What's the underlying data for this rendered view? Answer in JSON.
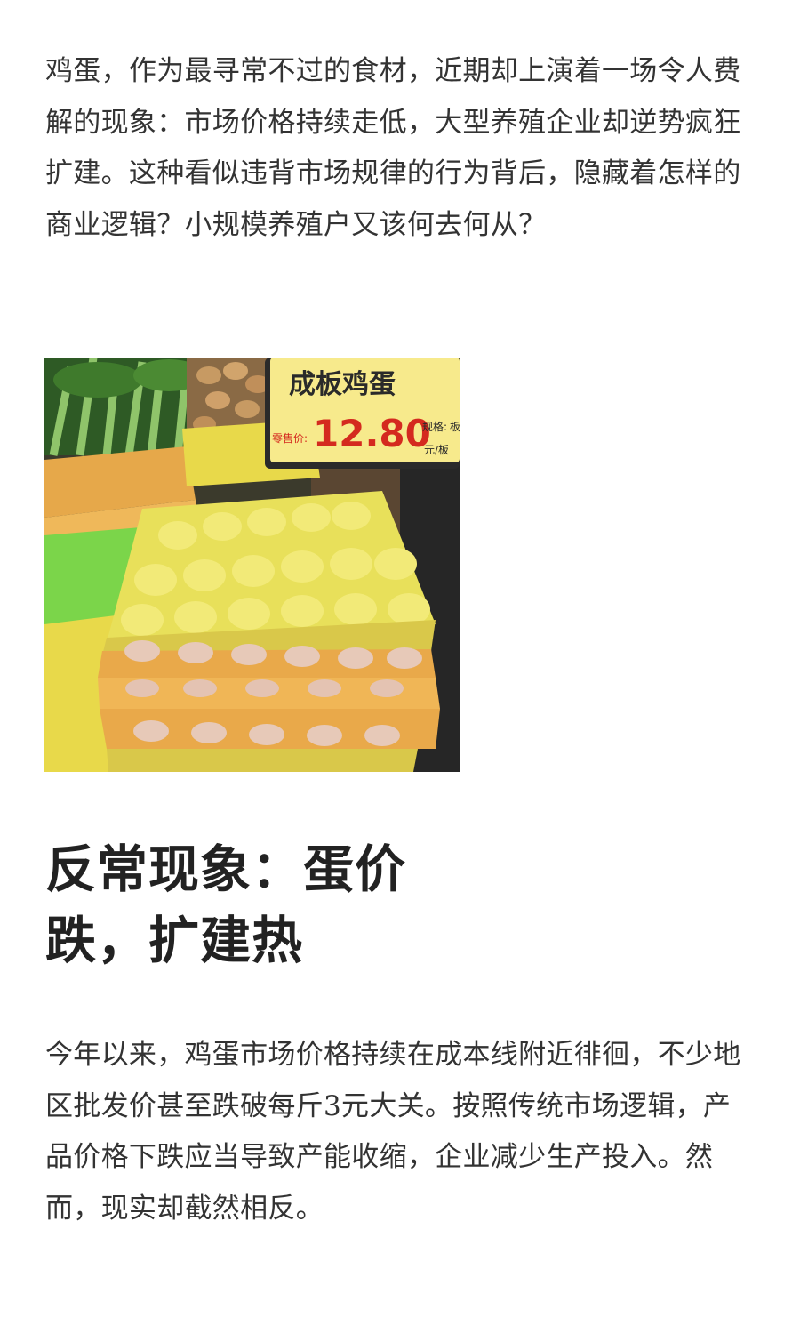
{
  "article": {
    "intro": "鸡蛋，作为最寻常不过的食材，近期却上演着一场令人费解的现象：市场价格持续走低，大型养殖企业却逆势疯狂扩建。这种看似违背市场规律的行为背后，隐藏着怎样的商业逻辑？小规模养殖户又该何去何从？",
    "photo": {
      "sign_title": "成板鸡蛋",
      "sign_price_label": "零售价:",
      "sign_price": "12.80",
      "sign_spec_label": "规格:",
      "sign_spec_value": "板",
      "sign_unit": "元/板"
    },
    "section_heading": "反常现象：蛋价跌，扩建热",
    "body": "今年以来，鸡蛋市场价格持续在成本线附近徘徊，不少地区批发价甚至跌破每斤3元大关。按照传统市场逻辑，产品价格下跌应当导致产能收缩，企业减少生产投入。然而，现实却截然相反。"
  },
  "colors": {
    "text": "#333333",
    "heading": "#222222",
    "sign_background": "#f7ea8c",
    "price_red": "#d42a1f",
    "tray_yellow": "#e8d94a",
    "tray_orange": "#e9a94a"
  }
}
